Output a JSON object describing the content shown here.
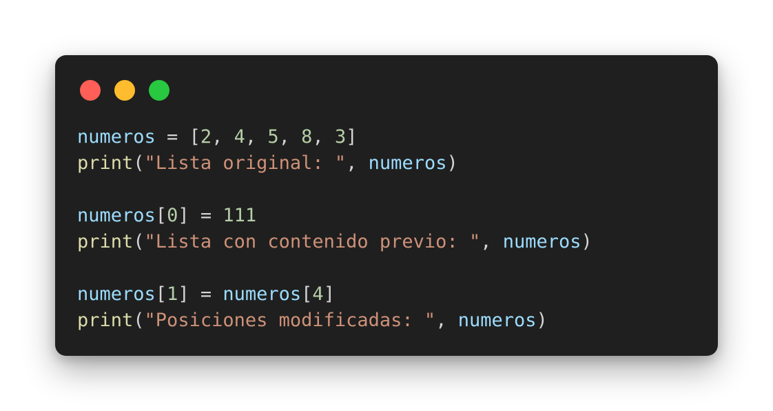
{
  "window": {
    "controls": [
      {
        "name": "close",
        "color": "#ff5f57"
      },
      {
        "name": "minimize",
        "color": "#febc2e"
      },
      {
        "name": "maximize",
        "color": "#28c840"
      }
    ]
  },
  "code": {
    "lines": [
      [
        {
          "type": "var",
          "text": "numeros"
        },
        {
          "type": "op",
          "text": " = ["
        },
        {
          "type": "num",
          "text": "2"
        },
        {
          "type": "op",
          "text": ", "
        },
        {
          "type": "num",
          "text": "4"
        },
        {
          "type": "op",
          "text": ", "
        },
        {
          "type": "num",
          "text": "5"
        },
        {
          "type": "op",
          "text": ", "
        },
        {
          "type": "num",
          "text": "8"
        },
        {
          "type": "op",
          "text": ", "
        },
        {
          "type": "num",
          "text": "3"
        },
        {
          "type": "op",
          "text": "]"
        }
      ],
      [
        {
          "type": "func",
          "text": "print"
        },
        {
          "type": "op",
          "text": "("
        },
        {
          "type": "str",
          "text": "\"Lista original: \""
        },
        {
          "type": "op",
          "text": ", "
        },
        {
          "type": "var",
          "text": "numeros"
        },
        {
          "type": "op",
          "text": ")"
        }
      ],
      [],
      [
        {
          "type": "var",
          "text": "numeros"
        },
        {
          "type": "op",
          "text": "["
        },
        {
          "type": "num",
          "text": "0"
        },
        {
          "type": "op",
          "text": "] = "
        },
        {
          "type": "num",
          "text": "111"
        }
      ],
      [
        {
          "type": "func",
          "text": "print"
        },
        {
          "type": "op",
          "text": "("
        },
        {
          "type": "str",
          "text": "\"Lista con contenido previo: \""
        },
        {
          "type": "op",
          "text": ", "
        },
        {
          "type": "var",
          "text": "numeros"
        },
        {
          "type": "op",
          "text": ")"
        }
      ],
      [],
      [
        {
          "type": "var",
          "text": "numeros"
        },
        {
          "type": "op",
          "text": "["
        },
        {
          "type": "num",
          "text": "1"
        },
        {
          "type": "op",
          "text": "] = "
        },
        {
          "type": "var",
          "text": "numeros"
        },
        {
          "type": "op",
          "text": "["
        },
        {
          "type": "num",
          "text": "4"
        },
        {
          "type": "op",
          "text": "]"
        }
      ],
      [
        {
          "type": "func",
          "text": "print"
        },
        {
          "type": "op",
          "text": "("
        },
        {
          "type": "str",
          "text": "\"Posiciones modificadas: \""
        },
        {
          "type": "op",
          "text": ", "
        },
        {
          "type": "var",
          "text": "numeros"
        },
        {
          "type": "op",
          "text": ")"
        }
      ]
    ]
  }
}
